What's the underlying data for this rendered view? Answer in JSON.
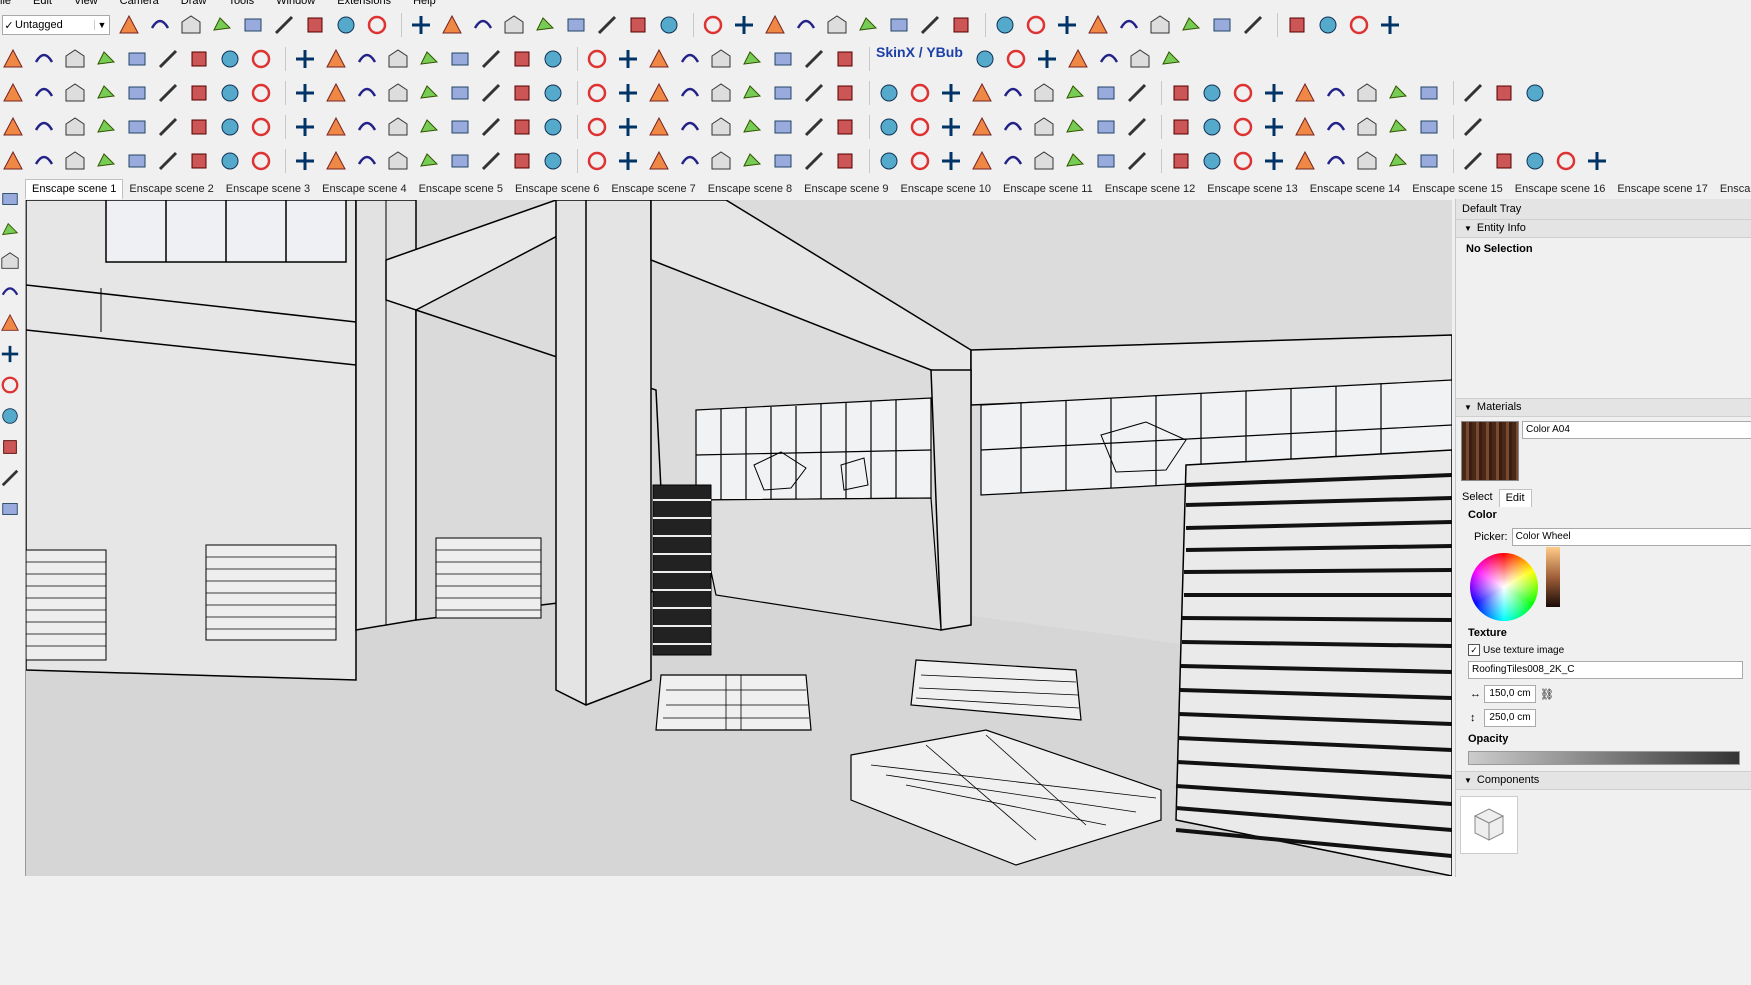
{
  "menu": [
    "ile",
    "Edit",
    "View",
    "Camera",
    "Draw",
    "Tools",
    "Window",
    "Extensions",
    "Help"
  ],
  "tag_selector": {
    "check": "✓",
    "value": "Untagged"
  },
  "skinx_label": "SkinX / YBub",
  "scene_tabs": [
    "Enscape scene 1",
    "Enscape scene 2",
    "Enscape scene 3",
    "Enscape scene 4",
    "Enscape scene 5",
    "Enscape scene 6",
    "Enscape scene 7",
    "Enscape scene 8",
    "Enscape scene 9",
    "Enscape scene 10",
    "Enscape scene 11",
    "Enscape scene 12",
    "Enscape scene 13",
    "Enscape scene 14",
    "Enscape scene 15",
    "Enscape scene 16",
    "Enscape scene 17",
    "Enscape sc"
  ],
  "tray": {
    "title": "Default Tray",
    "entity_info": {
      "header": "Entity Info",
      "status": "No Selection"
    },
    "materials": {
      "header": "Materials",
      "name": "Color A04",
      "tabs": [
        "Select",
        "Edit"
      ],
      "color_label": "Color",
      "picker_label": "Picker:",
      "picker_value": "Color Wheel",
      "texture_label": "Texture",
      "use_texture_label": "Use texture image",
      "texture_file": "RoofingTiles008_2K_C",
      "width_value": "150,0 cm",
      "height_value": "250,0 cm",
      "opacity_label": "Opacity"
    },
    "components": {
      "header": "Components"
    }
  },
  "colors": {
    "chrome": "#f0f0f0",
    "viewport_bg": "#dcdcdc",
    "accent_blue": "#1c3fa8",
    "material_swatch": "#5a3020"
  }
}
